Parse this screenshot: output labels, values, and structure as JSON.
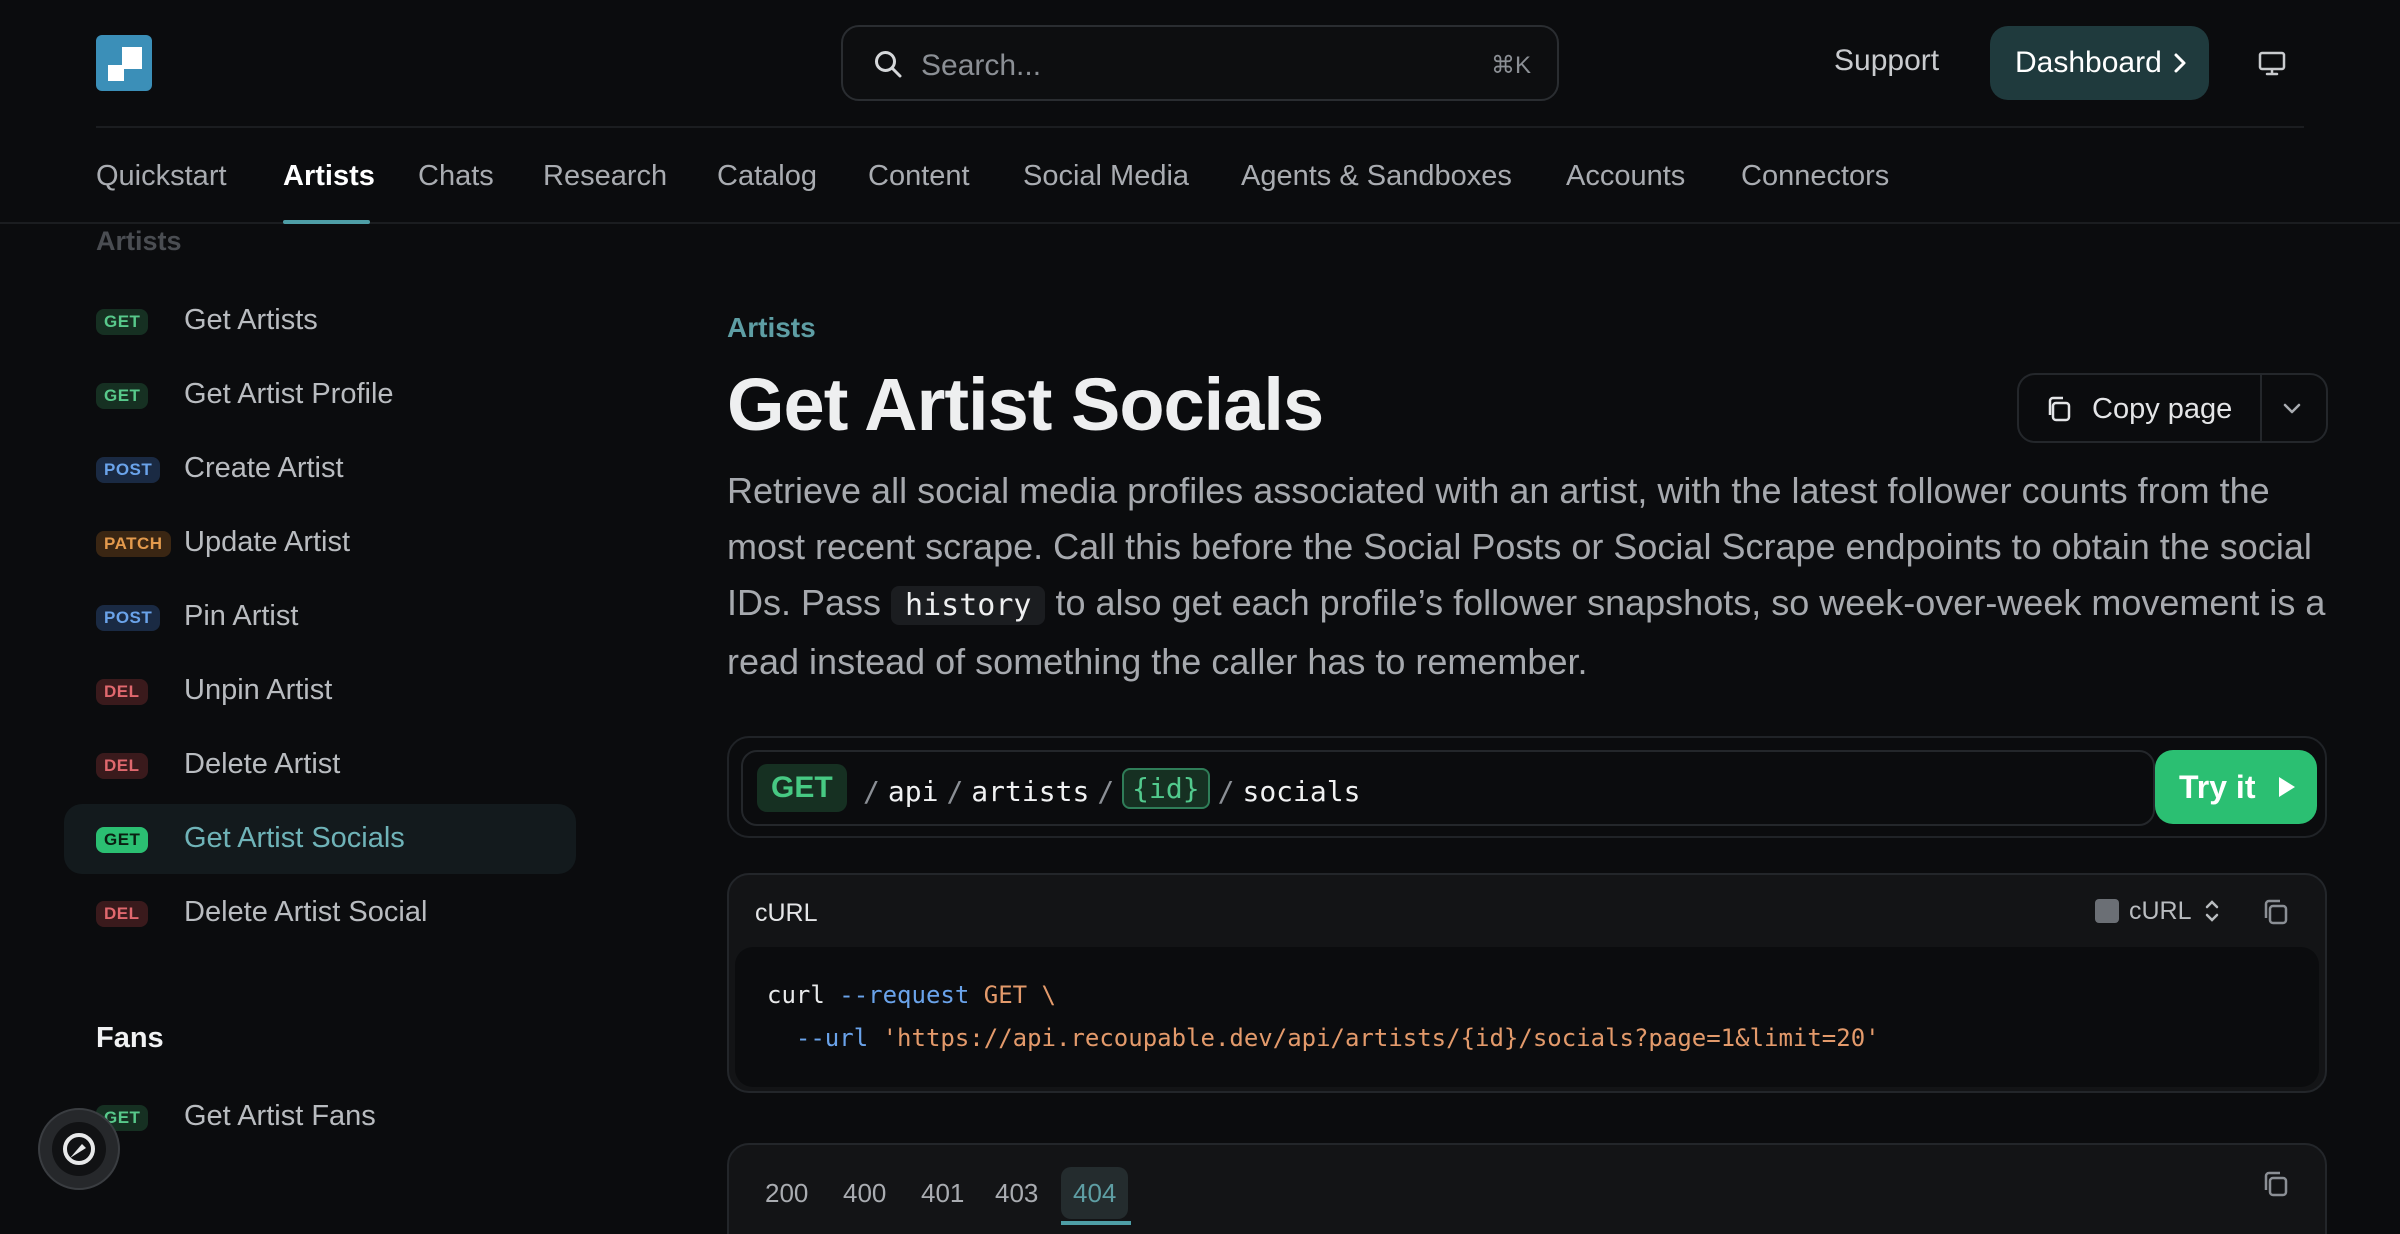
{
  "header": {
    "search_placeholder": "Search...",
    "search_shortcut": "⌘K",
    "support_label": "Support",
    "dashboard_label": "Dashboard"
  },
  "tabs": [
    {
      "label": "Quickstart",
      "active": false
    },
    {
      "label": "Artists",
      "active": true
    },
    {
      "label": "Chats",
      "active": false
    },
    {
      "label": "Research",
      "active": false
    },
    {
      "label": "Catalog",
      "active": false
    },
    {
      "label": "Content",
      "active": false
    },
    {
      "label": "Social Media",
      "active": false
    },
    {
      "label": "Agents & Sandboxes",
      "active": false
    },
    {
      "label": "Accounts",
      "active": false
    },
    {
      "label": "Connectors",
      "active": false
    }
  ],
  "sidebar": {
    "section_title": "Artists",
    "items": [
      {
        "method": "GET",
        "label": "Get Artists"
      },
      {
        "method": "GET",
        "label": "Get Artist Profile"
      },
      {
        "method": "POST",
        "label": "Create Artist"
      },
      {
        "method": "PATCH",
        "label": "Update Artist"
      },
      {
        "method": "POST",
        "label": "Pin Artist"
      },
      {
        "method": "DEL",
        "label": "Unpin Artist"
      },
      {
        "method": "DEL",
        "label": "Delete Artist"
      },
      {
        "method": "GET",
        "label": "Get Artist Socials",
        "active": true
      },
      {
        "method": "DEL",
        "label": "Delete Artist Social"
      }
    ],
    "fans_heading": "Fans",
    "fans_items": [
      {
        "method": "GET",
        "label": "Get Artist Fans"
      }
    ]
  },
  "page": {
    "breadcrumb": "Artists",
    "title": "Get Artist Socials",
    "copy_page_label": "Copy page",
    "description_before": "Retrieve all social media profiles associated with an artist, with the latest follower counts from the most recent scrape. Call this before the Social Posts or Social Scrape endpoints to obtain the social IDs. Pass ",
    "description_code": "history",
    "description_after": " to also get each profile’s follower snapshots, so week-over-week movement is a read instead of something the caller has to remember."
  },
  "endpoint": {
    "method": "GET",
    "segments": [
      "api",
      "artists",
      "{id}",
      "socials"
    ],
    "try_label": "Try it"
  },
  "code_example": {
    "title": "cURL",
    "language": "cURL",
    "line1_cmd": "curl",
    "line1_flag": "--request",
    "line1_value": "GET \\",
    "line2_flag": "--url",
    "line2_value": "'https://api.recoupable.dev/api/artists/{id}/socials?page=1&limit=20'"
  },
  "response": {
    "status_tabs": [
      "200",
      "400",
      "401",
      "403",
      "404"
    ],
    "active_status": "404"
  },
  "colors": {
    "accent": "#4e9ea6",
    "get": "#2bbf72",
    "post": "#6aa3ea",
    "patch": "#e39a4d",
    "delete": "#e0686e"
  }
}
